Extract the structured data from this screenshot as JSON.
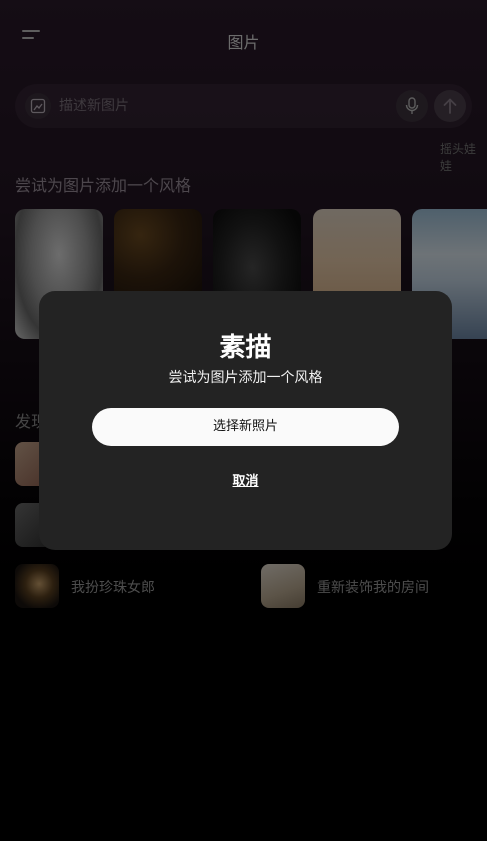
{
  "header": {
    "title": "图片"
  },
  "prompt": {
    "placeholder": "描述新图片"
  },
  "styles": {
    "section_title": "尝试为图片添加一个风格",
    "cards": [
      {
        "icon": "sketch-portrait"
      },
      {
        "icon": "bokeh-portrait"
      },
      {
        "icon": "dark-portrait"
      },
      {
        "icon": "cartoon-doll"
      },
      {
        "icon": "bobblehead-figure",
        "label": "摇头娃娃"
      }
    ]
  },
  "discover": {
    "title": "发现",
    "items": [
      {
        "label": "我扮珍珠女郎"
      },
      {
        "label": "重新装饰我的房间"
      }
    ]
  },
  "modal": {
    "title": "素描",
    "subtitle": "尝试为图片添加一个风格",
    "choose_label": "选择新照片",
    "cancel_label": "取消"
  }
}
